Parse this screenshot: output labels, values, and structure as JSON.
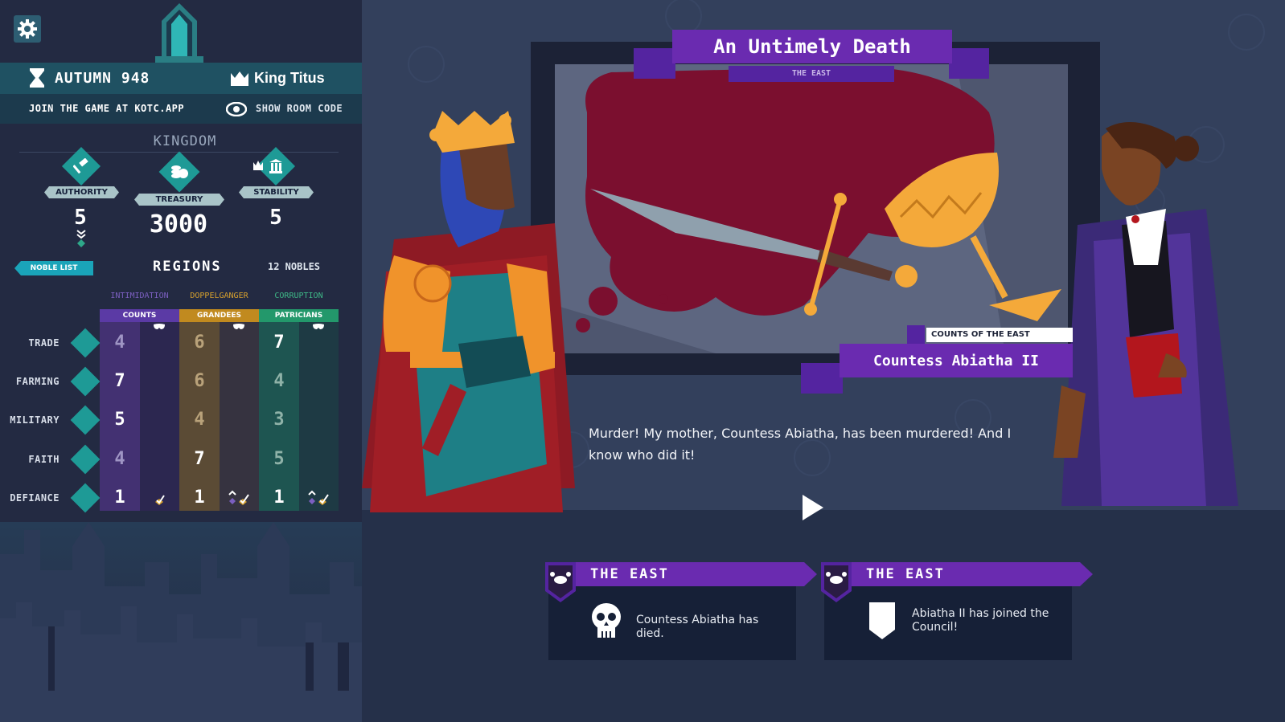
{
  "hud": {
    "season": "AUTUMN 948",
    "king": "King Titus",
    "join": "JOIN THE GAME AT KOTC.APP",
    "show_code": "SHOW ROOM CODE"
  },
  "kingdom": {
    "title": "KINGDOM",
    "stats": [
      {
        "label": "AUTHORITY",
        "value": "5",
        "icon": "gavel-icon"
      },
      {
        "label": "TREASURY",
        "value": "3000",
        "icon": "coins-icon"
      },
      {
        "label": "STABILITY",
        "value": "5",
        "icon": "pillar-icon"
      }
    ]
  },
  "regions": {
    "noble_list_label": "NOBLE LIST",
    "title": "REGIONS",
    "nobles_count": "12 NOBLES",
    "col_heads": [
      "INTIMIDATION",
      "DOPPELGANGER",
      "CORRUPTION"
    ],
    "factions": [
      "COUNTS",
      "GRANDEES",
      "PATRICIANS"
    ],
    "rows": [
      {
        "label": "TRADE",
        "icon": "hand-coin-icon",
        "values": [
          "4",
          "6",
          "7"
        ]
      },
      {
        "label": "FARMING",
        "icon": "sprout-icon",
        "values": [
          "7",
          "6",
          "4"
        ]
      },
      {
        "label": "MILITARY",
        "icon": "swords-icon",
        "values": [
          "5",
          "4",
          "3"
        ]
      },
      {
        "label": "FAITH",
        "icon": "faith-icon",
        "values": [
          "4",
          "7",
          "5"
        ]
      },
      {
        "label": "DEFIANCE",
        "icon": "flame-icon",
        "values": [
          "1",
          "1",
          "1"
        ]
      }
    ]
  },
  "event": {
    "title": "An Untimely Death",
    "region": "THE EAST",
    "speaker_faction": "COUNTS OF THE EAST",
    "speaker_name": "Countess Abiatha II",
    "dialogue": "Murder! My mother, Countess Abiatha, has been murdered! And I know who did it!"
  },
  "cards": [
    {
      "region": "THE EAST",
      "text": "Countess Abiatha has died.",
      "icon": "skull-icon"
    },
    {
      "region": "THE EAST",
      "text": "Abiatha II has joined the Council!",
      "icon": "shield-icon"
    }
  ],
  "colors": {
    "accent_purple": "#6a2bb0",
    "teal": "#1e9a96",
    "panel_bg": "#232a42",
    "counts": "#4b2e7e",
    "grandees": "#6b5530",
    "patricians": "#1f6050"
  }
}
